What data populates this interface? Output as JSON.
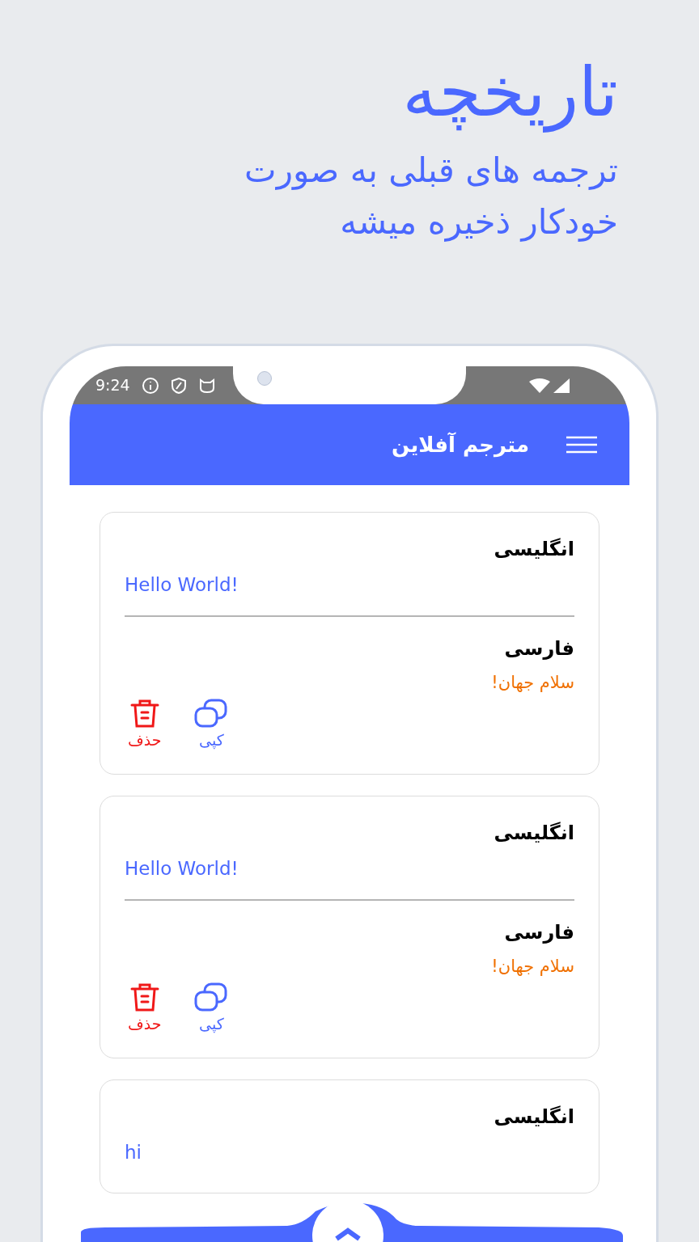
{
  "promo": {
    "title": "تاریخچه",
    "subtitle": "ترجمه های قبلی به صورت خودکار ذخیره میشه"
  },
  "status_bar": {
    "time": "9:24"
  },
  "app_bar": {
    "title": "مترجم آفلاین"
  },
  "cards": [
    {
      "source_language": "انگلیسی",
      "source_text": "Hello World!",
      "target_language": "فارسی",
      "target_text": "سلام جهان!",
      "actions": [
        {
          "kind": "copy",
          "label": "کپی"
        },
        {
          "kind": "delete",
          "label": "حذف"
        }
      ]
    },
    {
      "source_language": "انگلیسی",
      "source_text": "Hello World!",
      "target_language": "فارسی",
      "target_text": "سلام جهان!",
      "actions": [
        {
          "kind": "copy",
          "label": "کپی"
        },
        {
          "kind": "delete",
          "label": "حذف"
        }
      ]
    },
    {
      "source_language": "انگلیسی",
      "source_text": "hi"
    }
  ]
}
